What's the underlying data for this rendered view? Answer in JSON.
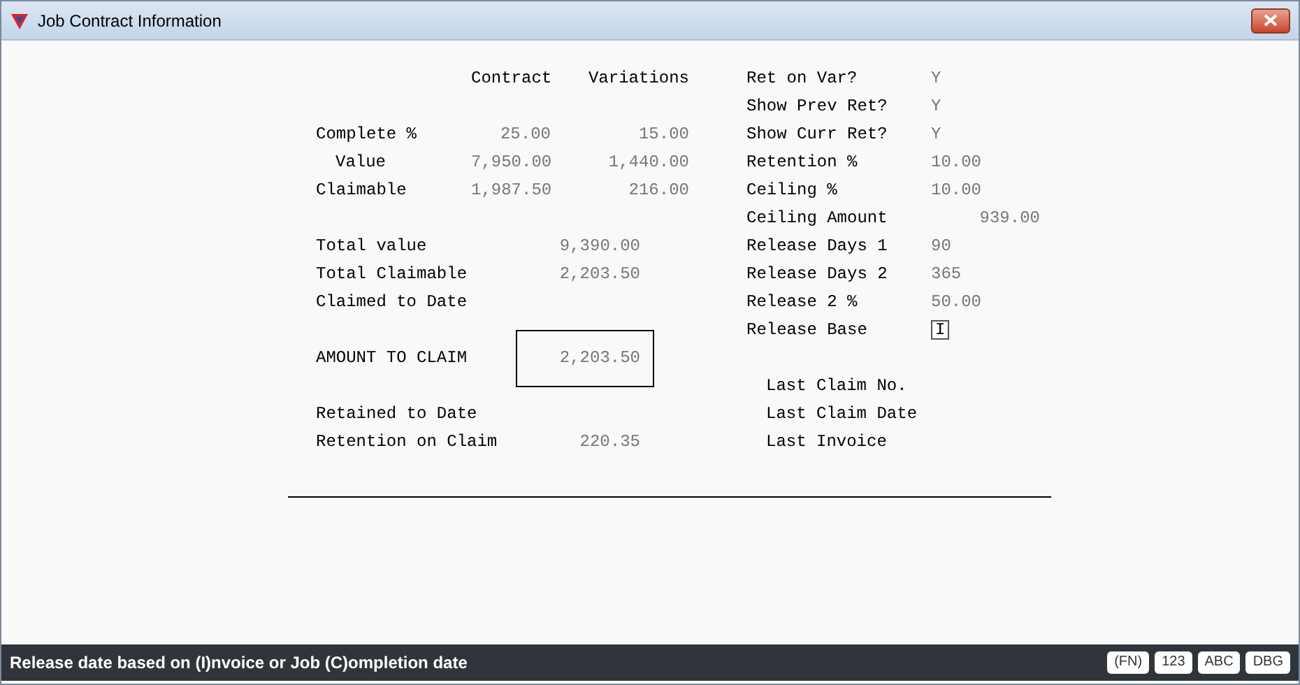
{
  "window": {
    "title": "Job Contract Information"
  },
  "columns": [
    "Contract",
    "Variations"
  ],
  "left_groups": [
    [
      {
        "kind": "pair",
        "label": "Complete %",
        "contract": "25.00",
        "variations": "15.00"
      },
      {
        "kind": "subpair",
        "label": "Value",
        "contract": "7,950.00",
        "variations": "1,440.00"
      },
      {
        "kind": "pair",
        "label": "Claimable",
        "contract": "1,987.50",
        "variations": "216.00"
      }
    ],
    [
      {
        "kind": "total",
        "label": "Total value",
        "value": "9,390.00"
      },
      {
        "kind": "total",
        "label": "Total Claimable",
        "value": "2,203.50"
      },
      {
        "kind": "total",
        "label": "Claimed to Date"
      }
    ],
    [
      {
        "kind": "boxed",
        "label": "AMOUNT TO CLAIM",
        "value": "2,203.50"
      }
    ],
    [
      {
        "kind": "total",
        "label": "Retained to Date"
      },
      {
        "kind": "total",
        "label": "Retention on Claim",
        "value": "220.35"
      }
    ]
  ],
  "right_fields": [
    {
      "kind": "text",
      "label": "Ret on Var?",
      "value": "Y"
    },
    {
      "kind": "text",
      "label": "Show Prev Ret?",
      "value": "Y"
    },
    {
      "kind": "text",
      "label": "Show Curr Ret?",
      "value": "Y"
    },
    {
      "kind": "text",
      "label": "Retention %",
      "value": "10.00"
    },
    {
      "kind": "text",
      "label": "Ceiling %",
      "value": "10.00"
    },
    {
      "kind": "wide",
      "label": "Ceiling Amount",
      "value": "939.00"
    },
    {
      "kind": "text",
      "label": "Release Days 1",
      "value": "90"
    },
    {
      "kind": "text",
      "label": "Release Days 2",
      "value": "365"
    },
    {
      "kind": "text",
      "label": "Release 2 %",
      "value": "50.00"
    },
    {
      "kind": "input",
      "label": "Release Base",
      "value": "I"
    }
  ],
  "last_claim": [
    "Last Claim No.",
    "Last Claim Date",
    "Last Invoice"
  ],
  "status_bar": {
    "message": "Release date based on (I)nvoice or Job (C)ompletion date",
    "badges": [
      "(FN)",
      "123",
      "ABC",
      "DBG"
    ]
  }
}
